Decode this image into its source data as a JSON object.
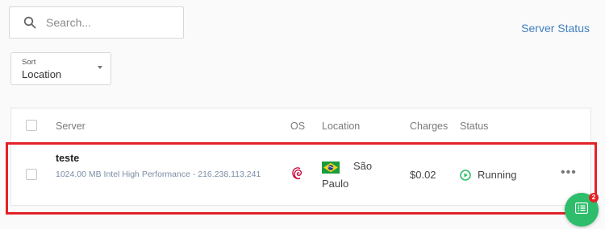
{
  "search": {
    "placeholder": "Search..."
  },
  "header": {
    "server_status_link": "Server Status"
  },
  "sort": {
    "label": "Sort",
    "value": "Location"
  },
  "table": {
    "columns": [
      "Server",
      "OS",
      "Location",
      "Charges",
      "Status"
    ],
    "rows": [
      {
        "name": "teste",
        "description": "1024.00 MB Intel High Performance - 216.238.113.241",
        "os_icon": "debian-icon",
        "location_flag": "brazil-flag-icon",
        "location_city": "São",
        "location_city_2": "Paulo",
        "charges": "$0.02",
        "status": "Running",
        "status_icon": "play-circle-icon",
        "actions_label": "•••"
      }
    ]
  },
  "chat": {
    "badge_count": "2",
    "icon": "chat-list-icon"
  },
  "colors": {
    "accent_link": "#3f7fbf",
    "status_running": "#2ebd6b",
    "highlight": "#e32227"
  }
}
